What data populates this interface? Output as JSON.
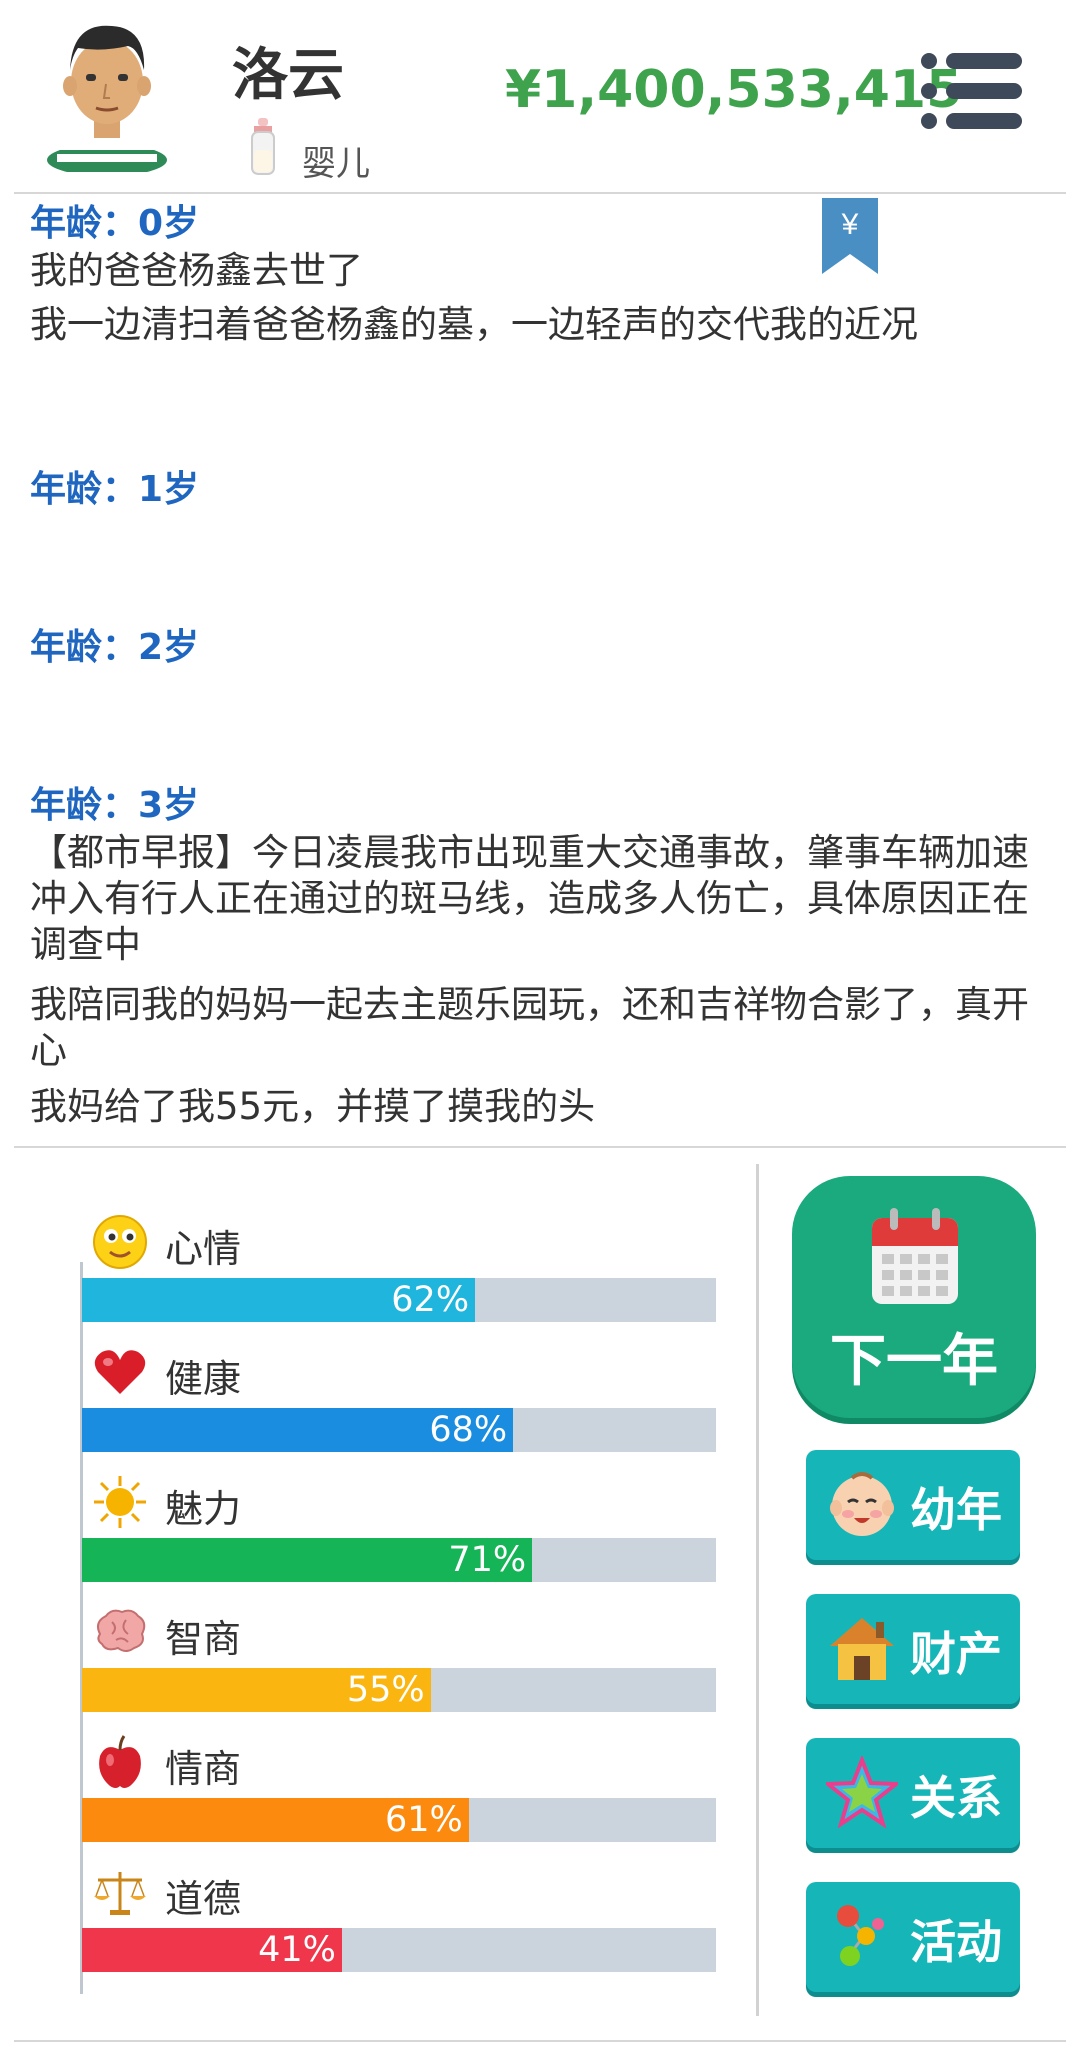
{
  "player": {
    "name": "洛云",
    "stage": "婴儿",
    "money": "¥1,400,533,415"
  },
  "log": {
    "bookmark_symbol": "¥",
    "entries": [
      {
        "age": "年龄：0岁",
        "lines": [
          "我的爸爸杨鑫去世了",
          "我一边清扫着爸爸杨鑫的墓，一边轻声的交代我的近况"
        ]
      },
      {
        "age": "年龄：1岁",
        "lines": []
      },
      {
        "age": "年龄：2岁",
        "lines": []
      },
      {
        "age": "年龄：3岁",
        "lines": [
          "【都市早报】今日凌晨我市出现重大交通事故，肇事车辆加速冲入有行人正在通过的斑马线，造成多人伤亡，具体原因正在调查中",
          "我陪同我的妈妈一起去主题乐园玩，还和吉祥物合影了，真开心",
          "我妈给了我55元，并摸了摸我的头"
        ]
      }
    ]
  },
  "stats": [
    {
      "label": "心情",
      "value": 62,
      "text": "62%",
      "color": "#1fb5dc",
      "icon": "smile-face-icon"
    },
    {
      "label": "健康",
      "value": 68,
      "text": "68%",
      "color": "#1a8de0",
      "icon": "heart-icon"
    },
    {
      "label": "魅力",
      "value": 71,
      "text": "71%",
      "color": "#15b457",
      "icon": "sun-icon"
    },
    {
      "label": "智商",
      "value": 55,
      "text": "55%",
      "color": "#fbb511",
      "icon": "brain-icon"
    },
    {
      "label": "情商",
      "value": 61,
      "text": "61%",
      "color": "#fb8a0f",
      "icon": "apple-icon"
    },
    {
      "label": "道德",
      "value": 41,
      "text": "41%",
      "color": "#f0364a",
      "icon": "scales-icon"
    }
  ],
  "buttons": {
    "next_year": "下一年",
    "side": [
      {
        "label": "幼年",
        "icon": "baby-face-icon"
      },
      {
        "label": "财产",
        "icon": "house-icon"
      },
      {
        "label": "关系",
        "icon": "star-icon"
      },
      {
        "label": "活动",
        "icon": "molecule-icon"
      }
    ]
  }
}
